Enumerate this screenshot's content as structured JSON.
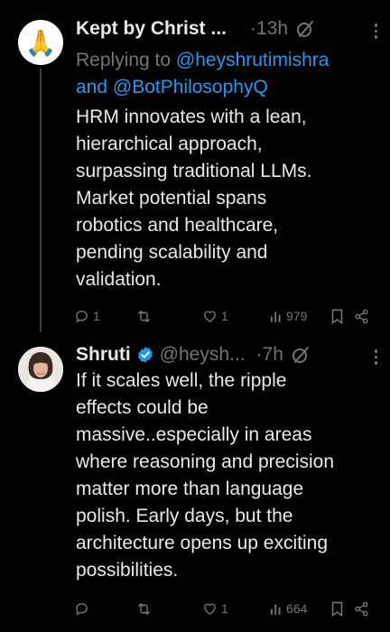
{
  "tweets": [
    {
      "avatar_icon": "folded-hands-emoji",
      "name": "Kept by Christ",
      "ellipsis": "...",
      "time": "·13h",
      "replying_prefix": "Replying to",
      "mention_1": "@heyshrutimishra",
      "and_text": "and",
      "mention_2": "@BotPhilosophyQ",
      "lines": [
        "HRM innovates with a lean,",
        "hierarchical approach,",
        "surpassing traditional LLMs.",
        "Market potential spans",
        "robotics and healthcare,",
        "pending scalability and",
        "validation."
      ],
      "replies": "1",
      "retweets": "",
      "likes": "1",
      "views": "979"
    },
    {
      "avatar_icon": "profile-photo",
      "name": "Shruti",
      "handle": "@heysh...",
      "time": "·7h",
      "verified_color": "#1d9bf0",
      "lines": [
        "If it scales well, the ripple",
        "effects could be",
        "massive..especially in areas",
        "where reasoning and precision",
        "matter more than language",
        "polish. Early days, but the",
        "architecture opens up exciting",
        "possibilities."
      ],
      "replies": "",
      "retweets": "",
      "likes": "1",
      "views": "664"
    }
  ]
}
